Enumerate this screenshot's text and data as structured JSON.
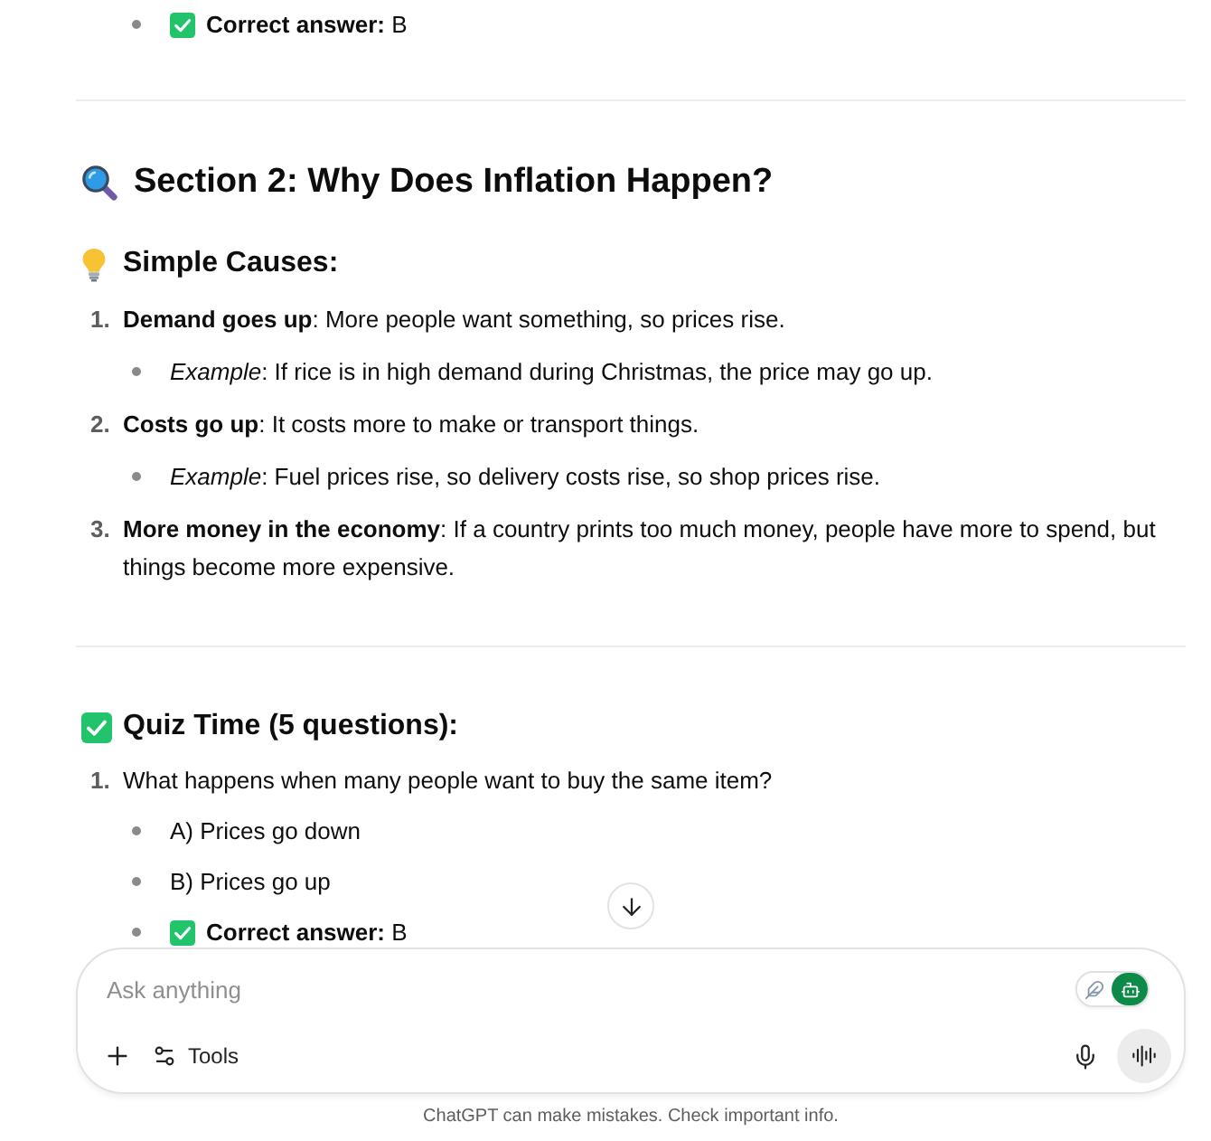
{
  "previous_quiz": {
    "items": [
      {
        "kind": "answer",
        "text": "**Correct answer:** B"
      }
    ]
  },
  "section": {
    "title": "Section 2: Why Does Inflation Happen?",
    "causes_heading": "Simple Causes:",
    "causes": [
      {
        "number": "1.",
        "text": "**Demand goes up**: More people want something, so prices rise.",
        "examples": [
          "*Example*: If rice is in high demand during Christmas, the price may go up."
        ]
      },
      {
        "number": "2.",
        "text": "**Costs go up**: It costs more to make or transport things.",
        "examples": [
          "*Example*: Fuel prices rise, so delivery costs rise, so shop prices rise."
        ]
      },
      {
        "number": "3.",
        "text": "**More money in the economy**: If a country prints too much money, people have more to spend, but things become more expensive."
      }
    ]
  },
  "quiz": {
    "title": "Quiz Time (5 questions):",
    "questions": [
      {
        "number": "1.",
        "text": "What happens when many people want to buy the same item?",
        "options": [
          {
            "kind": "option",
            "text": "A) Prices go down"
          },
          {
            "kind": "option",
            "text": "B) Prices go up"
          },
          {
            "kind": "answer",
            "text": "**Correct answer:** B"
          }
        ]
      }
    ]
  },
  "composer": {
    "placeholder": "Ask anything",
    "mode_toggle": [
      {
        "selected": false
      },
      {
        "selected": true
      }
    ],
    "tools_label": "Tools"
  },
  "disclaimer": "ChatGPT can make mistakes. Check important info."
}
